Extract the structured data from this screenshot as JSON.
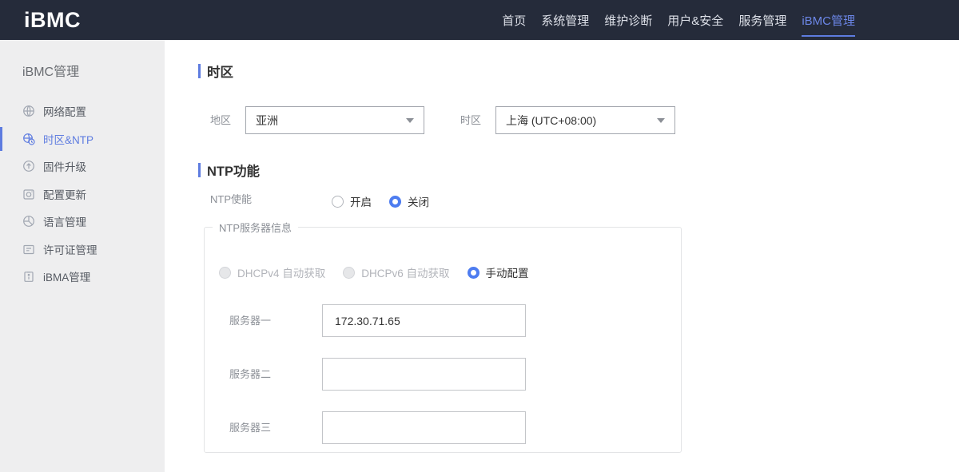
{
  "header": {
    "logo": "iBMC",
    "nav": [
      {
        "label": "首页"
      },
      {
        "label": "系统管理"
      },
      {
        "label": "维护诊断"
      },
      {
        "label": "用户&安全"
      },
      {
        "label": "服务管理"
      },
      {
        "label": "iBMC管理",
        "active": true
      }
    ]
  },
  "sidebar": {
    "title": "iBMC管理",
    "items": [
      {
        "label": "网络配置",
        "icon": "globe-icon",
        "active": false
      },
      {
        "label": "时区&NTP",
        "icon": "timezone-clock-icon",
        "active": true
      },
      {
        "label": "固件升级",
        "icon": "firmware-upgrade-icon",
        "active": false
      },
      {
        "label": "配置更新",
        "icon": "config-update-icon",
        "active": false
      },
      {
        "label": "语言管理",
        "icon": "language-icon",
        "active": false
      },
      {
        "label": "许可证管理",
        "icon": "license-icon",
        "active": false
      },
      {
        "label": "iBMA管理",
        "icon": "ibma-clipboard-icon",
        "active": false
      }
    ]
  },
  "main": {
    "timezone_section": {
      "title": "时区",
      "region_label": "地区",
      "region_value": "亚洲",
      "timezone_label": "时区",
      "timezone_value": "上海 (UTC+08:00)"
    },
    "ntp_section": {
      "title": "NTP功能",
      "enable_label": "NTP使能",
      "enable_options": [
        {
          "label": "开启",
          "selected": false
        },
        {
          "label": "关闭",
          "selected": true
        }
      ],
      "server_group": {
        "legend": "NTP服务器信息",
        "mode_options": [
          {
            "label": "DHCPv4 自动获取",
            "selected": false,
            "disabled": true
          },
          {
            "label": "DHCPv6 自动获取",
            "selected": false,
            "disabled": true
          },
          {
            "label": "手动配置",
            "selected": true,
            "disabled": false
          }
        ],
        "servers": [
          {
            "label": "服务器一",
            "value": "172.30.71.65"
          },
          {
            "label": "服务器二",
            "value": ""
          },
          {
            "label": "服务器三",
            "value": ""
          }
        ]
      }
    }
  },
  "colors": {
    "accent": "#5e7ce0",
    "radio_accent": "#4d7cf0",
    "header_bg": "#252b3a",
    "sidebar_bg": "#eeeeef"
  }
}
